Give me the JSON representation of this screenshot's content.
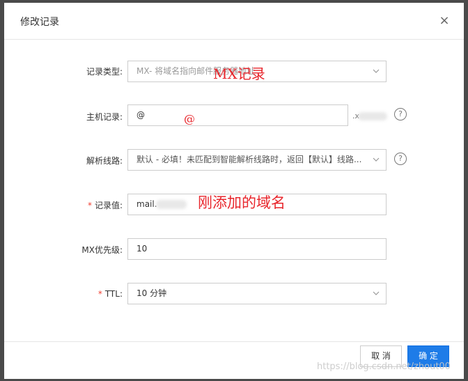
{
  "dialog": {
    "title": "修改记录",
    "close_icon": "×"
  },
  "form": {
    "record_type": {
      "label": "记录类型:",
      "value": "MX- 将域名指向邮件服务器地址",
      "annotation": "MX记录"
    },
    "host": {
      "label": "主机记录:",
      "value": "@",
      "suffix": ".x",
      "annotation": "@",
      "help": "?"
    },
    "line": {
      "label": "解析线路:",
      "value": "默认 - 必填！未匹配到智能解析线路时，返回【默认】线路...",
      "help": "?"
    },
    "record_value": {
      "required": "*",
      "label": "记录值:",
      "value": "mail.",
      "annotation": "刚添加的域名"
    },
    "mx_priority": {
      "label": "MX优先级:",
      "value": "10"
    },
    "ttl": {
      "required": "*",
      "label": "TTL:",
      "value": "10 分钟"
    }
  },
  "footer": {
    "cancel_label": "取 消",
    "ok_label": "确 定"
  },
  "watermark": "https://blog.csdn.net/zhout00",
  "colors": {
    "primary": "#1e7ce8",
    "annotation": "#e8262c",
    "required": "#f04134"
  }
}
